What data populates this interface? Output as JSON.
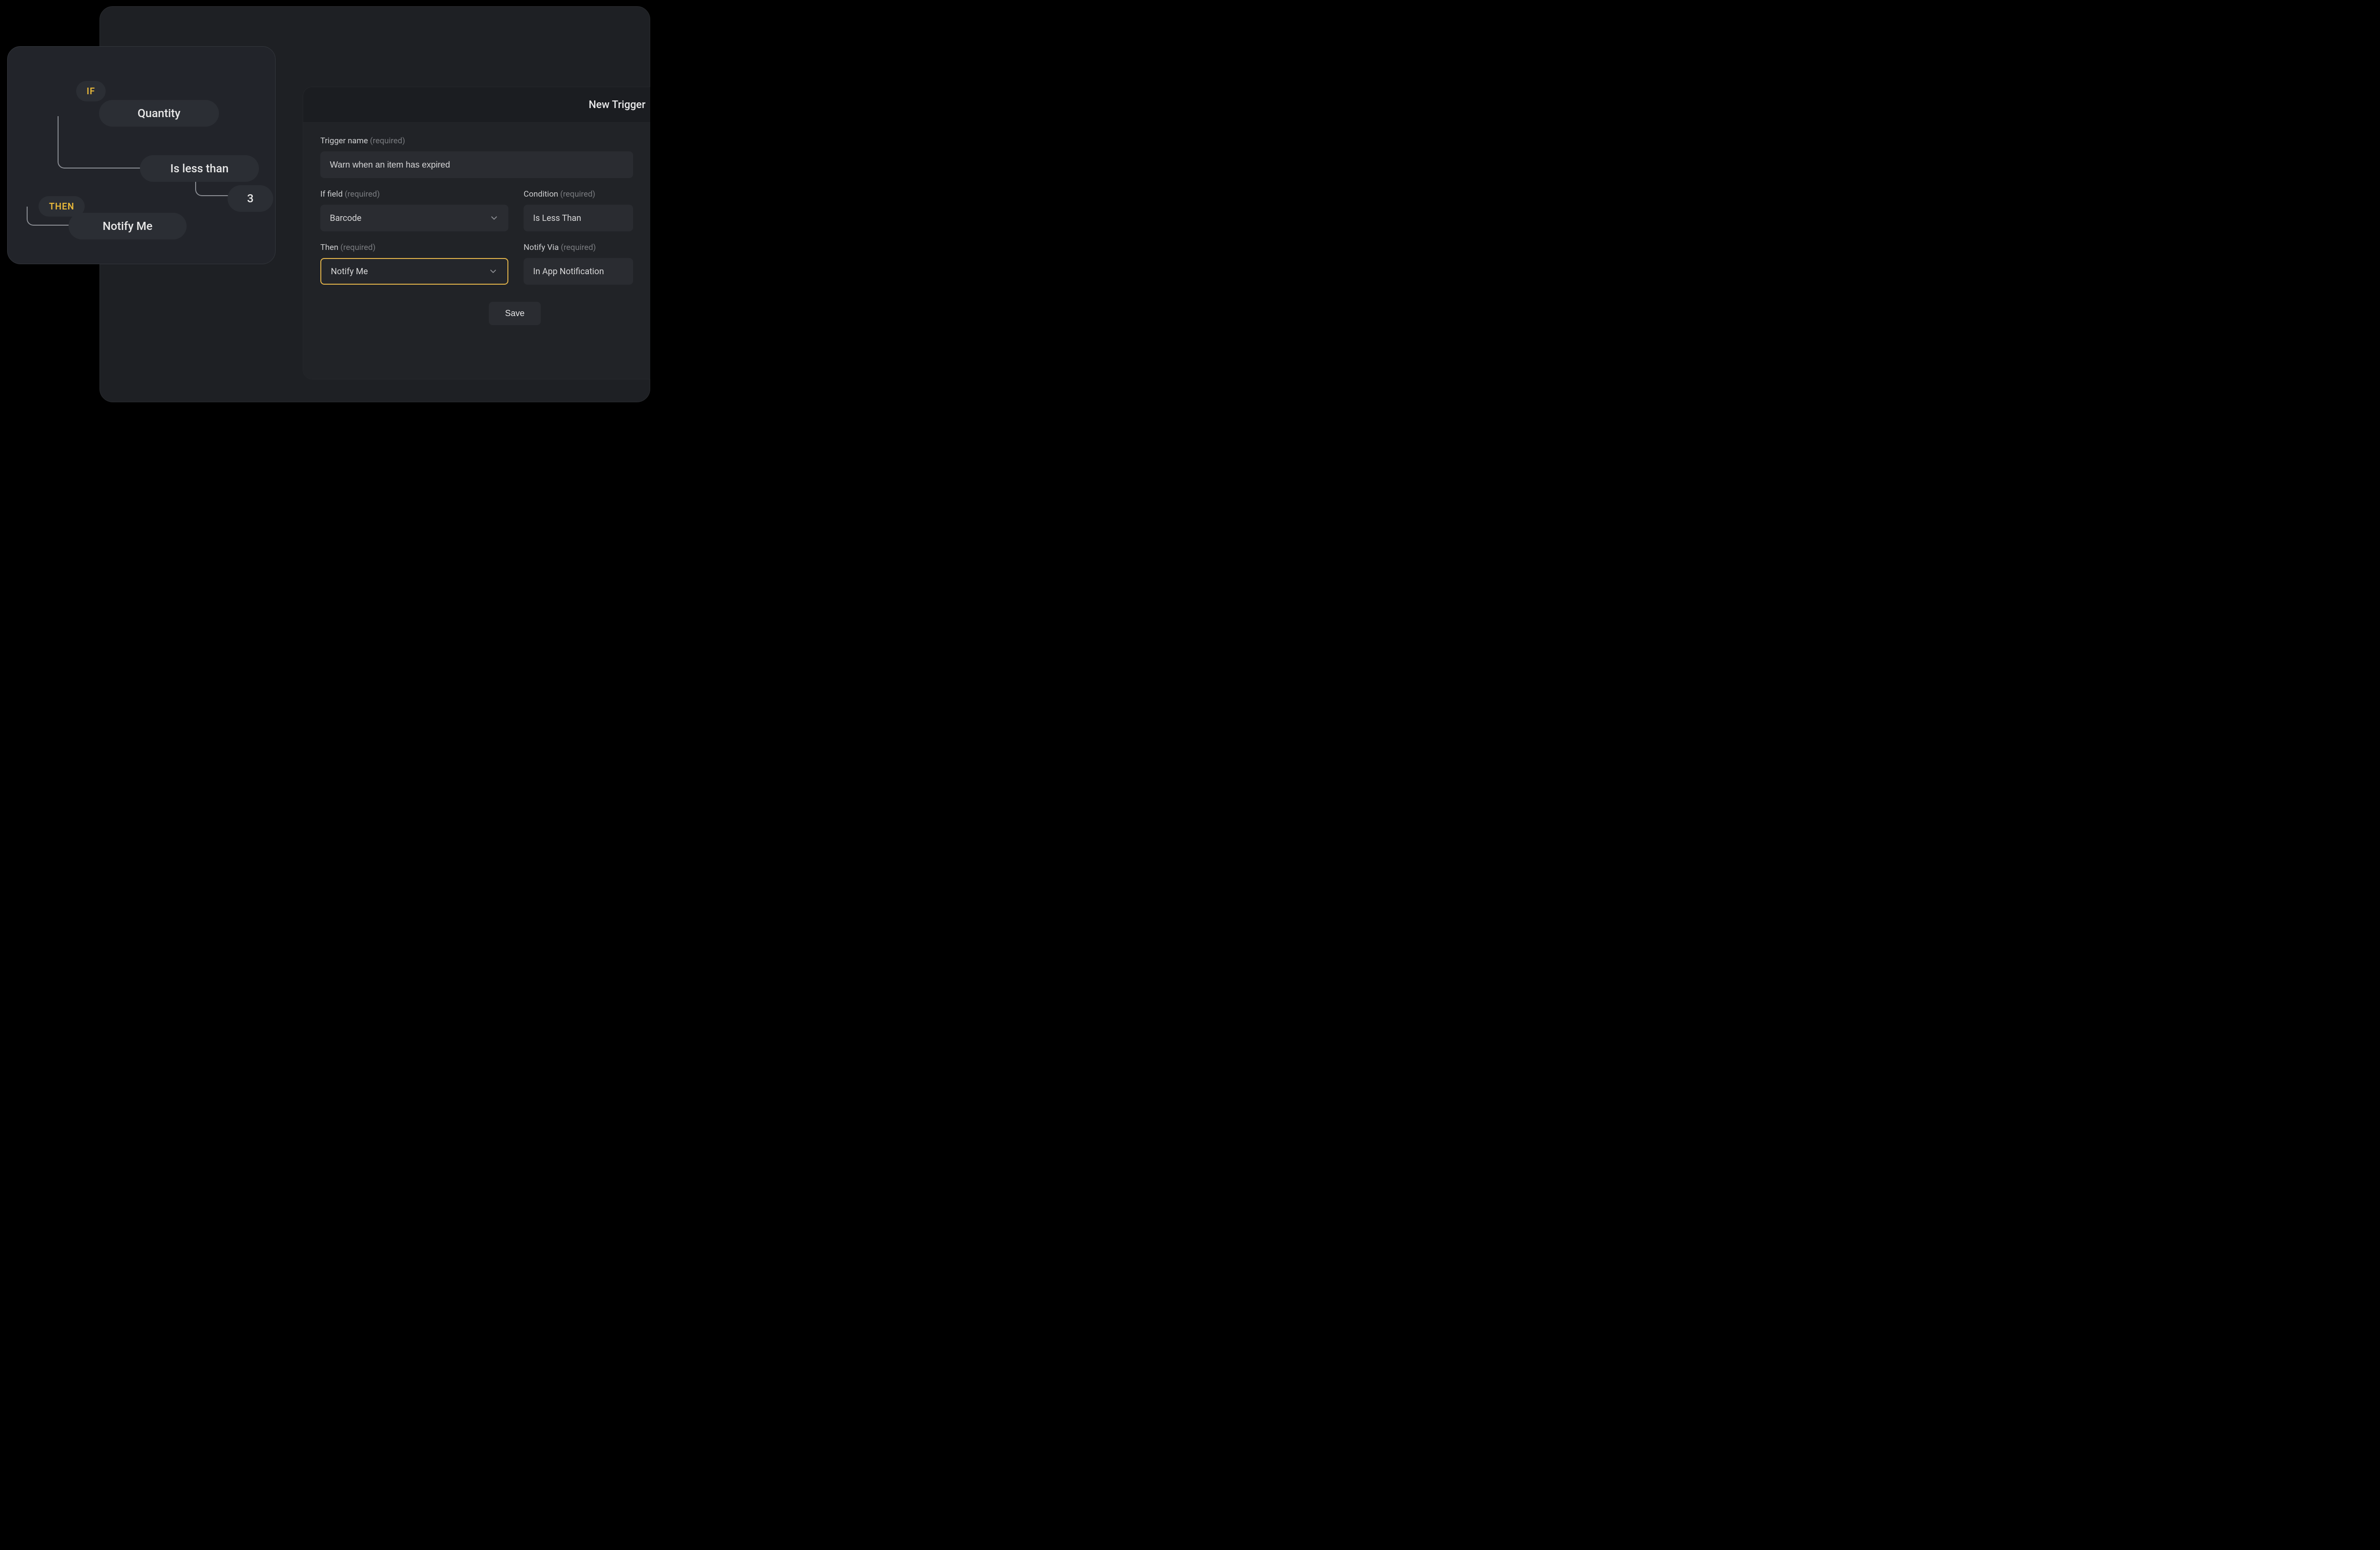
{
  "colors": {
    "accent": "#e0b24a",
    "bg_deep": "#000000",
    "panel": "#1e2024",
    "card": "#22242a",
    "pill": "#2b2e34",
    "text": "#e5e5e5",
    "muted": "#7a7c80"
  },
  "flow": {
    "if_keyword": "IF",
    "field_label": "Quantity",
    "operator_label": "Is less than",
    "value_label": "3",
    "then_keyword": "THEN",
    "action_label": "Notify Me"
  },
  "modal": {
    "title": "New Trigger",
    "trigger_name": {
      "label": "Trigger name",
      "required_hint": "(required)",
      "value": "Warn when an item has expired"
    },
    "if_field": {
      "label": "If field",
      "required_hint": "(required)",
      "selected": "Barcode"
    },
    "condition": {
      "label": "Condition",
      "required_hint": "(required)",
      "selected": "Is Less Than"
    },
    "then": {
      "label": "Then",
      "required_hint": "(required)",
      "selected": "Notify Me"
    },
    "notify_via": {
      "label": "Notify Via",
      "required_hint": "(required)",
      "selected": "In App Notification"
    },
    "save_label": "Save"
  }
}
